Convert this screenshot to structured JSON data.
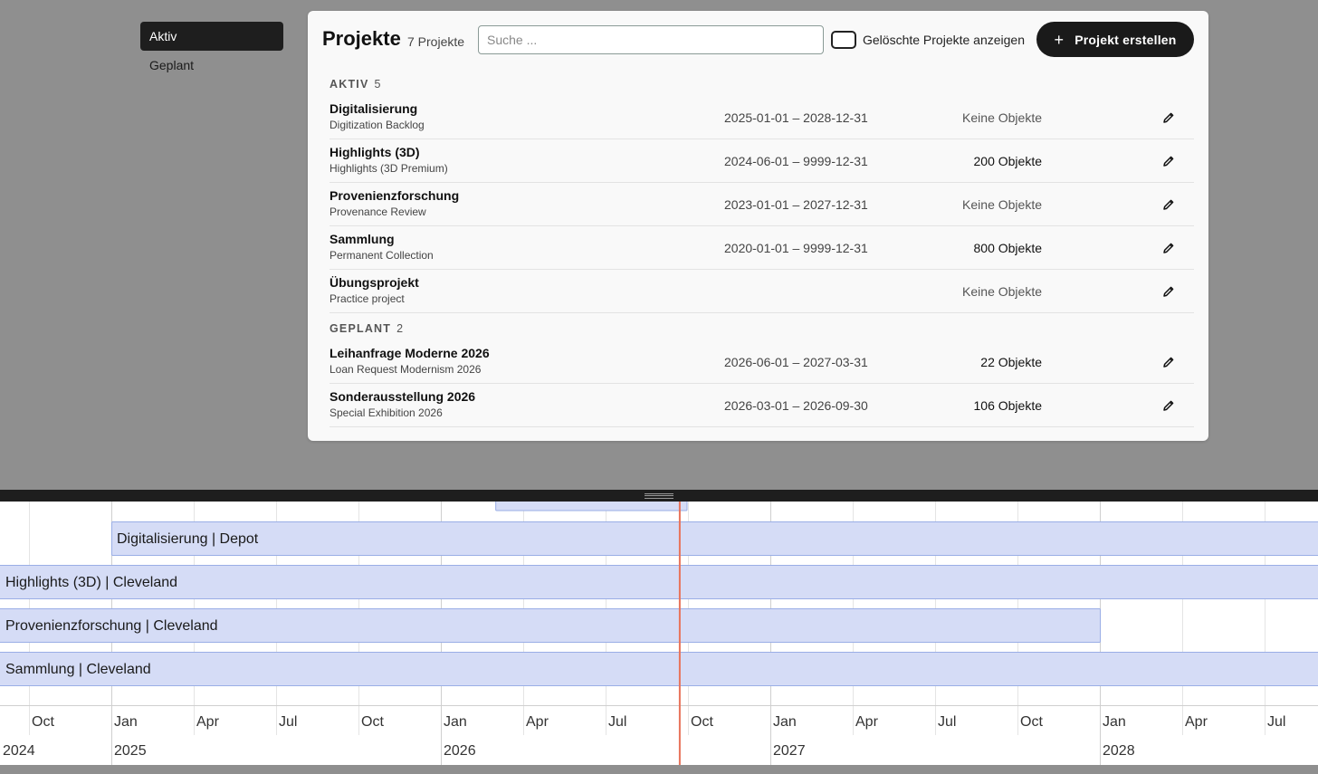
{
  "sidebar": {
    "items": [
      {
        "label": "Aktiv"
      },
      {
        "label": "Geplant"
      }
    ]
  },
  "header": {
    "title": "Projekte",
    "count": "7 Projekte",
    "search_placeholder": "Suche ...",
    "show_deleted_label": "Gelöschte Projekte anzeigen",
    "create_label": "Projekt erstellen"
  },
  "groups": [
    {
      "name": "AKTIV",
      "count": "5",
      "projects": [
        {
          "name": "Digitalisierung",
          "subtitle": "Digitization Backlog",
          "dates": "2025-01-01 – 2028-12-31",
          "objects": "Keine Objekte",
          "has_objects": false
        },
        {
          "name": "Highlights (3D)",
          "subtitle": "Highlights (3D Premium)",
          "dates": "2024-06-01 – 9999-12-31",
          "objects": "200 Objekte",
          "has_objects": true
        },
        {
          "name": "Provenienzforschung",
          "subtitle": "Provenance Review",
          "dates": "2023-01-01 – 2027-12-31",
          "objects": "Keine Objekte",
          "has_objects": false
        },
        {
          "name": "Sammlung",
          "subtitle": "Permanent Collection",
          "dates": "2020-01-01 – 9999-12-31",
          "objects": "800 Objekte",
          "has_objects": true
        },
        {
          "name": "Übungsprojekt",
          "subtitle": "Practice project",
          "dates": "",
          "objects": "Keine Objekte",
          "has_objects": false
        }
      ]
    },
    {
      "name": "GEPLANT",
      "count": "2",
      "projects": [
        {
          "name": "Leihanfrage Moderne 2026",
          "subtitle": "Loan Request Modernism 2026",
          "dates": "2026-06-01 – 2027-03-31",
          "objects": "22 Objekte",
          "has_objects": true
        },
        {
          "name": "Sonderausstellung 2026",
          "subtitle": "Special Exhibition 2026",
          "dates": "2026-03-01 – 2026-09-30",
          "objects": "106 Objekte",
          "has_objects": true
        }
      ]
    }
  ],
  "timeline": {
    "bars": [
      {
        "label": "Digitalisierung | Depot",
        "start": "2025-01-01",
        "end": "2028-12-31"
      },
      {
        "label": "Highlights (3D) | Cleveland",
        "start": "2024-06-01",
        "end": "9999-12-31"
      },
      {
        "label": "Provenienzforschung | Cleveland",
        "start": "2023-01-01",
        "end": "2027-12-31"
      },
      {
        "label": "Sammlung | Cleveland",
        "start": "2020-01-01",
        "end": "9999-12-31"
      }
    ],
    "partial_bar": {
      "start": "2026-03-01",
      "end": "2026-09-30"
    },
    "today": "2026-09-22",
    "months": [
      "Oct",
      "Jan",
      "Apr",
      "Jul",
      "Oct",
      "Jan",
      "Apr",
      "Jul",
      "Oct",
      "Jan",
      "Apr",
      "Jul",
      "Oct",
      "Jan",
      "Apr",
      "Jul"
    ],
    "years": [
      "2024",
      "2025",
      "2026",
      "2027",
      "2028"
    ],
    "colors": {
      "bar_fill": "#d5dcf6",
      "bar_stroke": "#9aaee6",
      "today_line": "#e8735a",
      "grid": "#e4e4e4"
    }
  }
}
